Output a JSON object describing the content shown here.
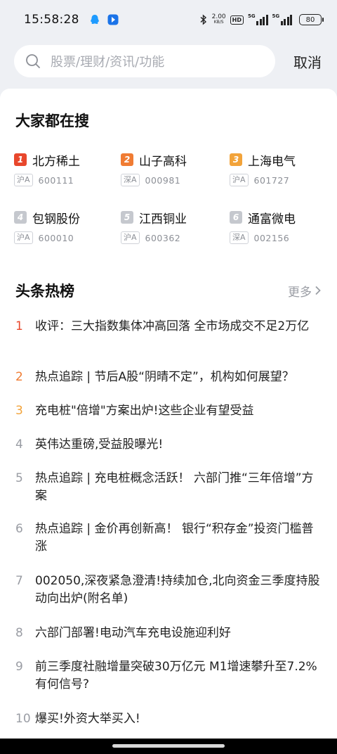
{
  "status_bar": {
    "time": "15:58:28",
    "net_speed_value": "2.00",
    "net_speed_unit": "KB/S",
    "hd_label": "HD",
    "signal_1_label": "5G",
    "signal_2_label": "5G",
    "battery": "80",
    "app_icons": [
      "qq-icon",
      "app-notification-icon"
    ]
  },
  "search": {
    "placeholder": "股票/理财/资讯/功能",
    "cancel_label": "取消"
  },
  "hot_search": {
    "title": "大家都在搜",
    "items": [
      {
        "rank": "1",
        "name": "北方稀土",
        "market": "沪A",
        "code": "600111",
        "badge_color": "#e8472c"
      },
      {
        "rank": "2",
        "name": "山子高科",
        "market": "深A",
        "code": "000981",
        "badge_color": "#f07c33"
      },
      {
        "rank": "3",
        "name": "上海电气",
        "market": "沪A",
        "code": "601727",
        "badge_color": "#f2a33a"
      },
      {
        "rank": "4",
        "name": "包钢股份",
        "market": "沪A",
        "code": "600010",
        "badge_color": "#c5c8ce"
      },
      {
        "rank": "5",
        "name": "江西铜业",
        "market": "沪A",
        "code": "600362",
        "badge_color": "#c5c8ce"
      },
      {
        "rank": "6",
        "name": "通富微电",
        "market": "深A",
        "code": "002156",
        "badge_color": "#c5c8ce"
      }
    ]
  },
  "news": {
    "title": "头条热榜",
    "more_label": "更多",
    "items": [
      {
        "rank": "1",
        "text": "收评：三大指数集体冲高回落 全市场成交不足2万亿"
      },
      {
        "rank": "2",
        "text": "热点追踪 | 节后A股“阴晴不定”，机构如何展望？"
      },
      {
        "rank": "3",
        "text": "充电桩\"倍增\"方案出炉!这些企业有望受益"
      },
      {
        "rank": "4",
        "text": "英伟达重磅,受益股曝光!"
      },
      {
        "rank": "5",
        "text": "热点追踪 | 充电桩概念活跃！ 六部门推“三年倍增”方案"
      },
      {
        "rank": "6",
        "text": "热点追踪 | 金价再创新高！ 银行“积存金”投资门槛普涨"
      },
      {
        "rank": "7",
        "text": "002050,深夜紧急澄清!持续加仓,北向资金三季度持股动向出炉(附名单)"
      },
      {
        "rank": "8",
        "text": "六部门部署!电动汽车充电设施迎利好"
      },
      {
        "rank": "9",
        "text": "前三季度社融增量突破30万亿元 M1增速攀升至7.2%有何信号?"
      },
      {
        "rank": "10",
        "text": "爆买!外资大举买入!"
      }
    ]
  },
  "colors": {
    "rank_1": "#e8472c",
    "rank_2": "#f07c33",
    "rank_3": "#f2a33a",
    "rank_other": "#c5c8ce",
    "page_bg": "#eef0f4"
  }
}
